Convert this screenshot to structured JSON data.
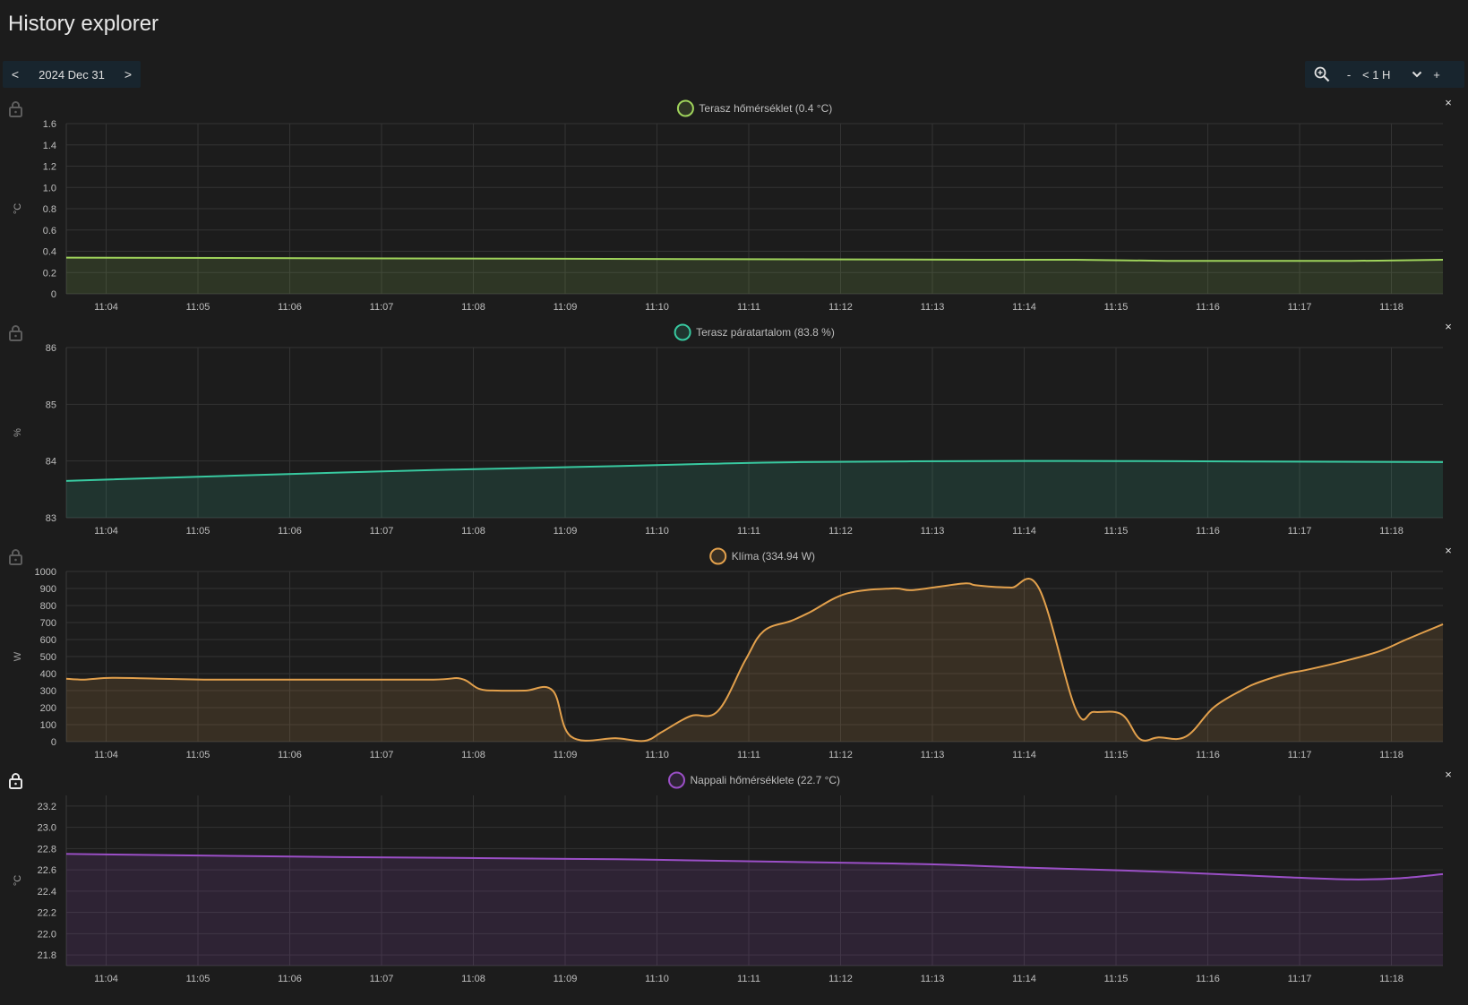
{
  "page": {
    "title": "History explorer"
  },
  "date_nav": {
    "prev": "<",
    "date": "2024 Dec 31",
    "next": ">"
  },
  "zoom": {
    "icon": "zoom-in-icon",
    "minus": "-",
    "range": "< 1 H",
    "plus": "+"
  },
  "x_ticks": [
    "11:04",
    "11:05",
    "11:06",
    "11:07",
    "11:08",
    "11:09",
    "11:10",
    "11:11",
    "11:12",
    "11:13",
    "11:14",
    "11:15",
    "11:16",
    "11:17",
    "11:18"
  ],
  "chart_data": [
    {
      "type": "area",
      "name": "terasz-homerseklet",
      "legend": "Terasz hőmérséklet (0.4 °C)",
      "ylabel": "°C",
      "color": "#9fd35b",
      "locked": false,
      "ylim": [
        0,
        1.6
      ],
      "y_ticks": [
        "0",
        "0.2",
        "0.4",
        "0.6",
        "0.8",
        "1.0",
        "1.2",
        "1.4",
        "1.6"
      ],
      "x_minutes": [
        0,
        5,
        10,
        11,
        12,
        13,
        14,
        15
      ],
      "values": [
        0.34,
        0.33,
        0.32,
        0.32,
        0.31,
        0.31,
        0.31,
        0.32
      ]
    },
    {
      "type": "area",
      "name": "terasz-paratartalom",
      "legend": "Terasz páratartalom (83.8 %)",
      "ylabel": "%",
      "color": "#38c9a0",
      "locked": false,
      "ylim": [
        83,
        86
      ],
      "y_ticks": [
        "83",
        "84",
        "85",
        "86"
      ],
      "x_minutes": [
        0,
        2,
        4,
        6,
        7,
        8,
        10,
        11.5,
        13,
        15
      ],
      "values": [
        83.65,
        83.75,
        83.84,
        83.91,
        83.95,
        83.98,
        84.0,
        84.0,
        83.99,
        83.98
      ]
    },
    {
      "type": "area",
      "name": "klima",
      "legend": "Klíma (334.94 W)",
      "ylabel": "W",
      "color": "#e2a04c",
      "locked": false,
      "ylim": [
        0,
        1000
      ],
      "y_ticks": [
        "0",
        "100",
        "200",
        "300",
        "400",
        "500",
        "600",
        "700",
        "800",
        "900",
        "1000"
      ],
      "x_minutes": [
        0,
        0.2,
        0.5,
        1,
        1.5,
        2,
        3,
        4,
        4.3,
        4.5,
        4.7,
        5,
        5.3,
        5.5,
        6,
        6.3,
        6.5,
        6.8,
        7.1,
        7.4,
        7.6,
        7.9,
        8.1,
        8.5,
        9,
        9.2,
        9.5,
        9.8,
        9.9,
        10.1,
        10.3,
        10.6,
        11,
        11.2,
        11.5,
        11.7,
        11.9,
        12.2,
        12.5,
        12.8,
        13,
        13.3,
        13.5,
        13.9,
        14.3,
        14.6,
        15
      ],
      "values": [
        370,
        365,
        375,
        370,
        365,
        365,
        365,
        365,
        370,
        310,
        300,
        300,
        300,
        30,
        20,
        5,
        60,
        150,
        180,
        480,
        650,
        710,
        760,
        870,
        900,
        890,
        910,
        930,
        920,
        910,
        905,
        900,
        190,
        175,
        160,
        15,
        25,
        30,
        200,
        300,
        350,
        400,
        420,
        470,
        530,
        600,
        690
      ]
    },
    {
      "type": "area",
      "name": "nappali-homerseklete",
      "legend": "Nappali hőmérséklete (22.7 °C)",
      "ylabel": "°C",
      "color": "#9b4fc7",
      "locked": true,
      "ylim": [
        21.7,
        23.3
      ],
      "y_ticks": [
        "21.8",
        "22.0",
        "22.2",
        "22.4",
        "22.6",
        "22.8",
        "23.0",
        "23.2"
      ],
      "x_minutes": [
        0,
        3,
        6,
        9,
        10.5,
        12,
        13.3,
        14,
        14.5,
        15
      ],
      "values": [
        22.75,
        22.72,
        22.7,
        22.66,
        22.62,
        22.58,
        22.53,
        22.51,
        22.52,
        22.56
      ]
    }
  ]
}
